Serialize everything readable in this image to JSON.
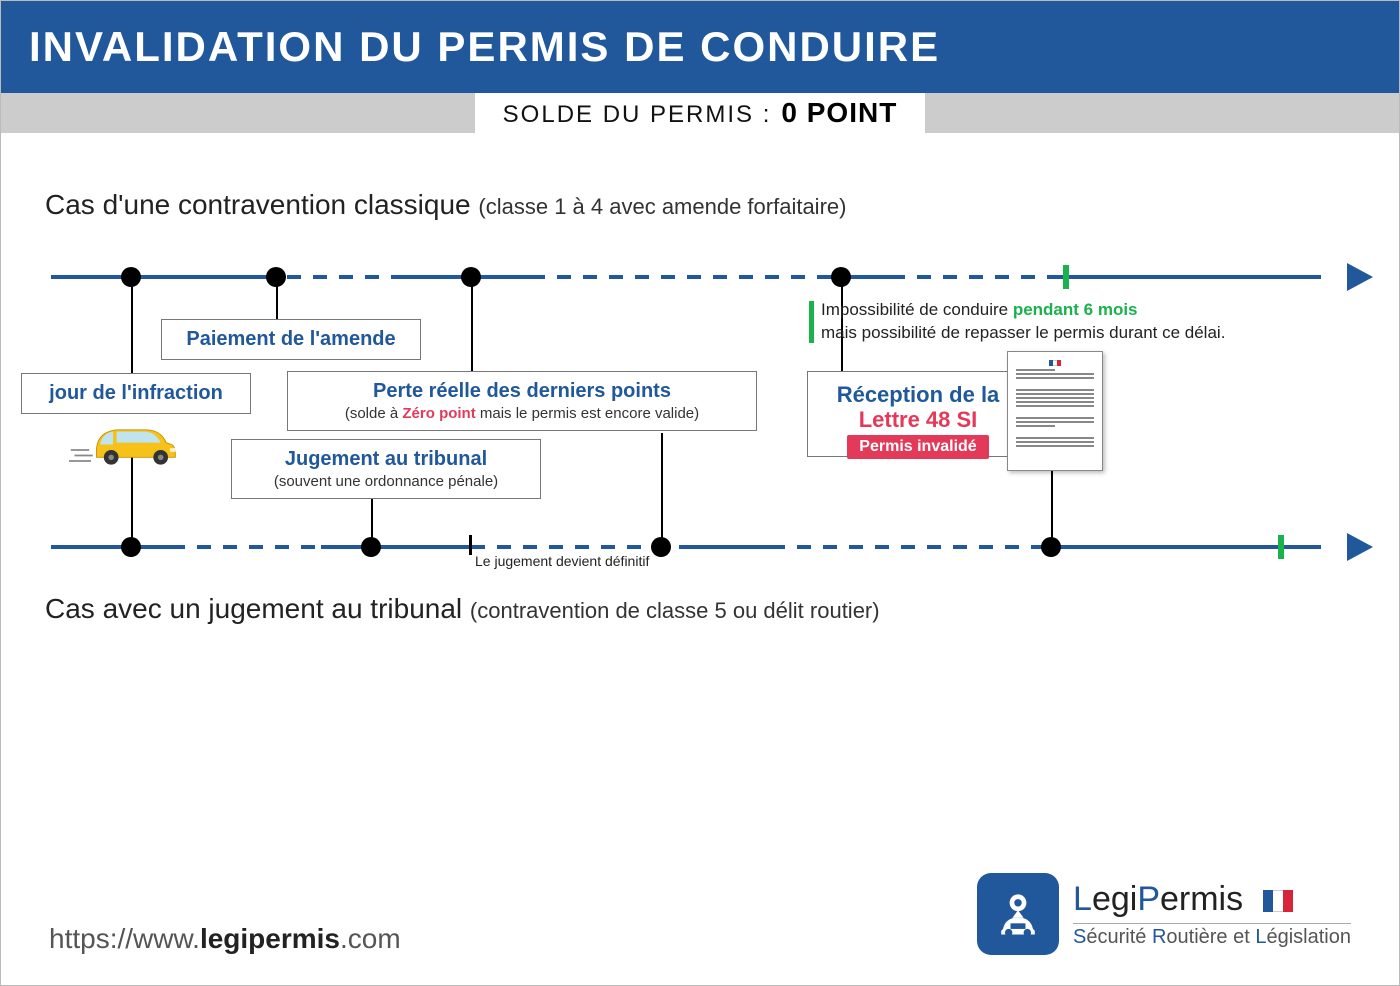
{
  "header": {
    "title": "INVALIDATION DU PERMIS DE CONDUIRE"
  },
  "subheader": {
    "label": "SOLDE DU PERMIS :",
    "value": "0 POINT"
  },
  "cases": {
    "top": {
      "title": "Cas d'une contravention classique ",
      "sub": "(classe 1 à 4 avec amende forfaitaire)"
    },
    "bottom": {
      "title": "Cas avec un jugement au tribunal ",
      "sub": "(contravention de classe 5 ou délit routier)"
    }
  },
  "events": {
    "infraction": {
      "title": "jour de l'infraction",
      "note": ""
    },
    "paiement": {
      "title": "Paiement de l'amende",
      "note": ""
    },
    "perte": {
      "title": "Perte réelle des derniers points",
      "note_pre": "(solde à ",
      "note_em": "Zéro point",
      "note_post": " mais le permis est encore valide)"
    },
    "jugement": {
      "title": "Jugement au tribunal",
      "note": "(souvent une ordonnance pénale)"
    },
    "reception": {
      "title": "Réception de la",
      "letter": "Lettre 48 SI",
      "badge": "Permis invalidé"
    }
  },
  "info": {
    "line1_pre": "Impossibilité de conduire ",
    "line1_em": "pendant 6 mois",
    "line2": "mais possibilité de repasser le permis durant ce délai."
  },
  "small_note": "Le jugement devient définitif",
  "footer": {
    "url_pre": "https://www.",
    "url_bold": "legipermis",
    "url_post": ".com",
    "brand_l": "L",
    "brand_rest1": "egi",
    "brand_p": "P",
    "brand_rest2": "ermis",
    "tag_s": "S",
    "tag_1": "écurité ",
    "tag_r": "R",
    "tag_2": "outière et ",
    "tag_li": "L",
    "tag_3": "égislation"
  },
  "chart_data": {
    "type": "timeline",
    "timelines": [
      {
        "name": "contravention_classique",
        "events": [
          "jour de l'infraction",
          "Paiement de l'amende",
          "Perte réelle des derniers points",
          "Réception de la Lettre 48 SI (Permis invalidé)"
        ],
        "suspension_duration": "6 mois"
      },
      {
        "name": "jugement_tribunal",
        "events": [
          "jour de l'infraction",
          "Jugement au tribunal",
          "Le jugement devient définitif",
          "Perte réelle des derniers points",
          "Réception de la Lettre 48 SI (Permis invalidé)"
        ],
        "suspension_duration": "6 mois"
      }
    ]
  }
}
